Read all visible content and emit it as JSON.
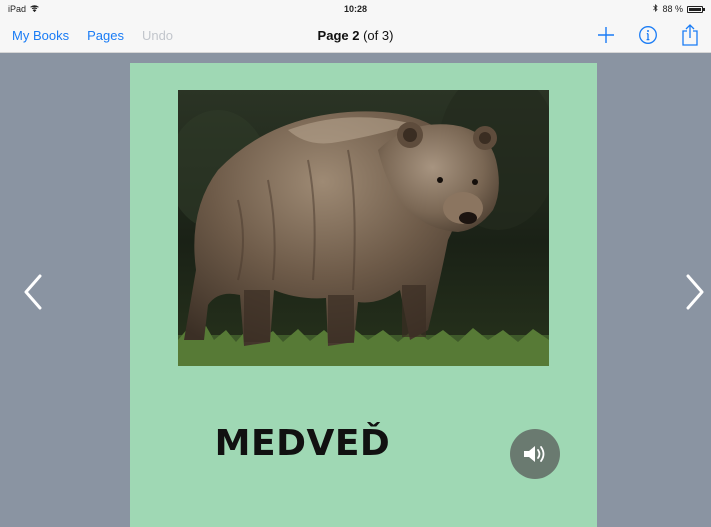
{
  "status_bar": {
    "device": "iPad",
    "time": "10:28",
    "battery": "88 %",
    "battery_level": 0.88
  },
  "nav": {
    "my_books": "My Books",
    "pages": "Pages",
    "undo": "Undo",
    "title_page": "Page 2",
    "title_of": "(of 3)",
    "accent_color": "#1a7cf5"
  },
  "page": {
    "word": "MEDVEĎ",
    "background_color": "#9fd8b4",
    "image_subject": "brown-bear-photo"
  },
  "icons": {
    "add": "plus-icon",
    "info": "info-icon",
    "share": "share-icon",
    "sound": "speaker-icon",
    "prev": "chevron-left-icon",
    "next": "chevron-right-icon"
  }
}
